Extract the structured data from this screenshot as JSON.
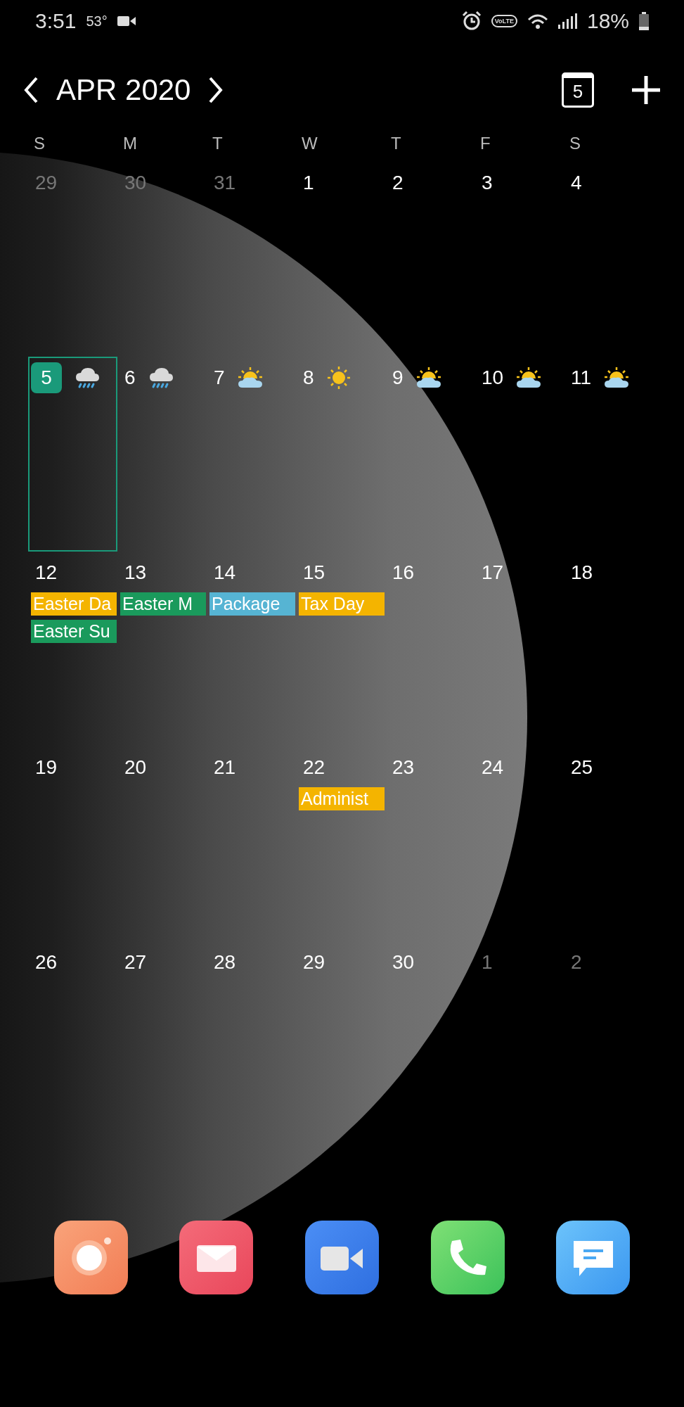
{
  "status_bar": {
    "time": "3:51",
    "temperature": "53°",
    "volte": "VoLTE",
    "battery": "18%"
  },
  "header": {
    "month": "APR 2020",
    "today_button": "5"
  },
  "weekdays": [
    "S",
    "M",
    "T",
    "W",
    "T",
    "F",
    "S"
  ],
  "weeks": [
    {
      "days": [
        {
          "date": "29",
          "muted": true,
          "selected": false
        },
        {
          "date": "30",
          "muted": true,
          "selected": false
        },
        {
          "date": "31",
          "muted": true,
          "selected": false
        },
        {
          "date": "1",
          "muted": false,
          "selected": false
        },
        {
          "date": "2",
          "muted": false,
          "selected": false
        },
        {
          "date": "3",
          "muted": false,
          "selected": false
        },
        {
          "date": "4",
          "muted": false,
          "selected": false
        }
      ]
    },
    {
      "days": [
        {
          "date": "5",
          "muted": false,
          "selected": true,
          "weather": {
            "kind": "rain"
          }
        },
        {
          "date": "6",
          "muted": false,
          "selected": false,
          "weather": {
            "kind": "rain"
          }
        },
        {
          "date": "7",
          "muted": false,
          "selected": false,
          "weather": {
            "kind": "partly-sunny"
          }
        },
        {
          "date": "8",
          "muted": false,
          "selected": false,
          "weather": {
            "kind": "sunny"
          }
        },
        {
          "date": "9",
          "muted": false,
          "selected": false,
          "weather": {
            "kind": "partly-sunny"
          }
        },
        {
          "date": "10",
          "muted": false,
          "selected": false,
          "weather": {
            "kind": "partly-sunny"
          }
        },
        {
          "date": "11",
          "muted": false,
          "selected": false,
          "weather": {
            "kind": "partly-sunny"
          }
        }
      ]
    },
    {
      "days": [
        {
          "date": "12",
          "muted": false,
          "selected": false,
          "events": [
            {
              "title": "Easter Da",
              "color": "#f4b400"
            },
            {
              "title": "Easter Su",
              "color": "#1a9a5c"
            }
          ]
        },
        {
          "date": "13",
          "muted": false,
          "selected": false,
          "events": [
            {
              "title": "Easter M",
              "color": "#1a9a5c"
            }
          ]
        },
        {
          "date": "14",
          "muted": false,
          "selected": false,
          "events": [
            {
              "title": "Package",
              "color": "#56b4d3"
            }
          ]
        },
        {
          "date": "15",
          "muted": false,
          "selected": false,
          "events": [
            {
              "title": "Tax Day",
              "color": "#f4b400"
            }
          ]
        },
        {
          "date": "16",
          "muted": false,
          "selected": false
        },
        {
          "date": "17",
          "muted": false,
          "selected": false
        },
        {
          "date": "18",
          "muted": false,
          "selected": false
        }
      ]
    },
    {
      "days": [
        {
          "date": "19",
          "muted": false,
          "selected": false
        },
        {
          "date": "20",
          "muted": false,
          "selected": false
        },
        {
          "date": "21",
          "muted": false,
          "selected": false
        },
        {
          "date": "22",
          "muted": false,
          "selected": false,
          "events": [
            {
              "title": "Administ",
              "color": "#f4b400"
            }
          ]
        },
        {
          "date": "23",
          "muted": false,
          "selected": false
        },
        {
          "date": "24",
          "muted": false,
          "selected": false
        },
        {
          "date": "25",
          "muted": false,
          "selected": false
        }
      ]
    },
    {
      "days": [
        {
          "date": "26",
          "muted": false,
          "selected": false
        },
        {
          "date": "27",
          "muted": false,
          "selected": false
        },
        {
          "date": "28",
          "muted": false,
          "selected": false
        },
        {
          "date": "29",
          "muted": false,
          "selected": false
        },
        {
          "date": "30",
          "muted": false,
          "selected": false
        },
        {
          "date": "1",
          "muted": true,
          "selected": false
        },
        {
          "date": "2",
          "muted": true,
          "selected": false
        }
      ]
    }
  ],
  "dock": [
    {
      "kind": "camera"
    },
    {
      "kind": "email"
    },
    {
      "kind": "video"
    },
    {
      "kind": "phone"
    },
    {
      "kind": "messages"
    }
  ]
}
